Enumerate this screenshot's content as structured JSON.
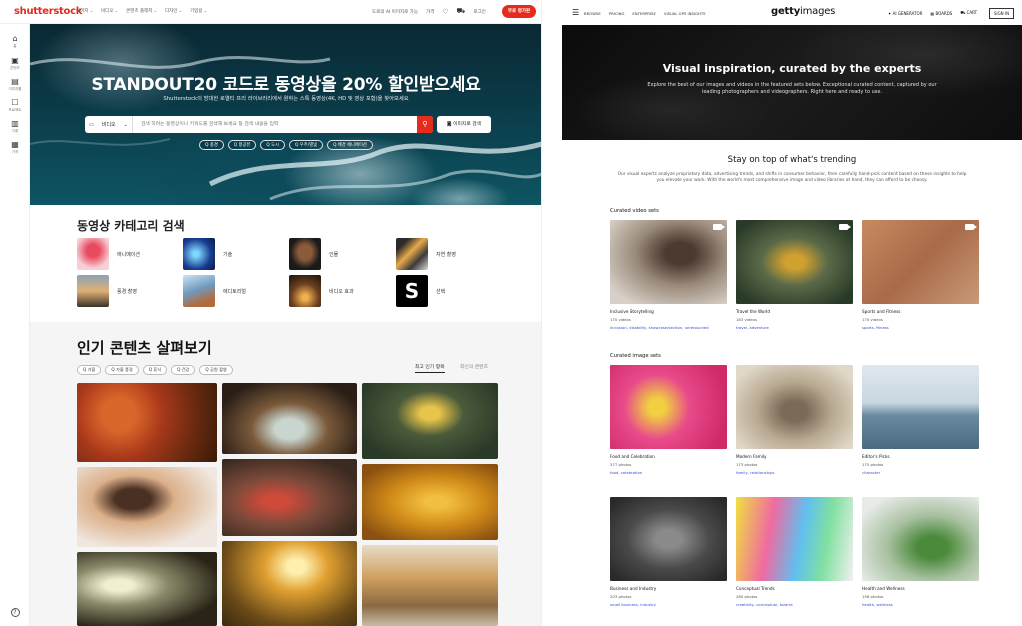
{
  "shutterstock": {
    "logo": "shutterstock",
    "nav": [
      "이미지",
      "비디오",
      "콘텐츠 플래저",
      "디자인",
      "기업용"
    ],
    "top_right": {
      "ai_label": "도로의 AI 이미지로 가능",
      "price": "가격",
      "login": "로그인",
      "signup": "무료 평가판"
    },
    "sidebar": [
      {
        "label": "홈",
        "icon": "home-icon"
      },
      {
        "label": "콘텐츠",
        "icon": "content-icon"
      },
      {
        "label": "이미지를",
        "icon": "image-icon"
      },
      {
        "label": "프로젝트",
        "icon": "project-icon"
      },
      {
        "label": "기록",
        "icon": "history-icon"
      },
      {
        "label": "가격",
        "icon": "price-icon"
      }
    ],
    "help_icon": "?",
    "hero": {
      "title": "STANDOUT20 코드로 동영상을 20% 할인받으세요",
      "subtitle": "Shutterstock의 방대한 로열티 프리 라이브러리에서 원하는 스톡 동영상(4K, HD 및 영상 포함)을 찾아보세요",
      "select": "비디오",
      "search_placeholder": "검색 하려는 동영상이나 키워드를 검색해 보세요 등 검색 내용을 입력",
      "image_search": "이미지로 검색",
      "chips": [
        "Q 풍경",
        "Q 항공뷰",
        "Q 도시",
        "Q 우주/별빛",
        "Q 배경 애니메이션"
      ]
    },
    "categories": {
      "title": "동영상 카테고리 검색",
      "items": [
        "애니메이션",
        "기술",
        "인물",
        "자연 촬영",
        "풍경 촬영",
        "에디토리얼",
        "비디오 효과",
        "선택"
      ]
    },
    "popular": {
      "title": "인기 콘텐츠 살펴보기",
      "chips": [
        "Q 가을",
        "Q 가을 풍경",
        "Q 휴식",
        "Q 건강",
        "Q 공원 촬영"
      ],
      "tab_active": "최고 인기 항목",
      "tab_other": "최신의 콘텐츠"
    }
  },
  "getty": {
    "logo_bold": "getty",
    "logo_light": "images",
    "nav": [
      "BROWSE",
      "PRICING",
      "ENTERPRISE",
      "VISUAL GPS INSIGHTS"
    ],
    "top_right": [
      "AI GENERATOR",
      "BOARDS",
      "CART"
    ],
    "sign_in": "SIGN IN",
    "hero": {
      "title": "Visual inspiration, curated by the experts",
      "subtitle": "Explore the best of our images and videos in the featured sets below. Exceptional curated content, captured by our leading photographers and videographers. Right here and ready to use."
    },
    "trending": {
      "title": "Stay on top of what's trending",
      "text": "Our visual experts analyze proprietary data, advertising trends, and shifts in consumer behavior, then carefully hand-pick content based on these insights to help you elevate your work. With the world's most comprehensive image and video libraries at hand, they can afford to be choosy."
    },
    "video_sets": {
      "title": "Curated video sets",
      "cards": [
        {
          "title": "Inclusive Storytelling",
          "count": "170 videos",
          "tags": "inclusion, disability, showcase/section, unretouched"
        },
        {
          "title": "Travel the World",
          "count": "183 videos",
          "tags": "travel, adventure"
        },
        {
          "title": "Sports and Fitness",
          "count": "170 videos",
          "tags": "sports, fitness"
        }
      ]
    },
    "image_sets": {
      "title": "Curated image sets",
      "cards": [
        {
          "title": "Food and Celebration",
          "count": "377 photos",
          "tags": "food, celebration"
        },
        {
          "title": "Modern Family",
          "count": "173 photos",
          "tags": "family, relationships"
        },
        {
          "title": "Editor's Picks",
          "count": "175 photos",
          "tags": "character"
        },
        {
          "title": "Business and Industry",
          "count": "203 photos",
          "tags": "small business, industry"
        },
        {
          "title": "Conceptual Trends",
          "count": "260 photos",
          "tags": "creativity, conceptual, bizarre"
        },
        {
          "title": "Health and Wellness",
          "count": "198 photos",
          "tags": "health, wellness"
        }
      ]
    }
  }
}
